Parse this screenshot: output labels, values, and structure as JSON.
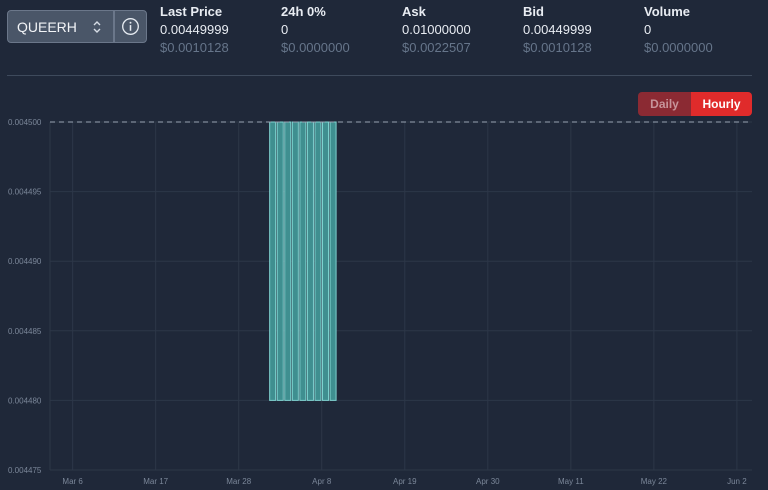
{
  "pair_selector": {
    "value": "QUEERH"
  },
  "stats": [
    {
      "label": "Last Price",
      "value": "0.00449999",
      "sub": "$0.0010128"
    },
    {
      "label": "24h 0%",
      "value": "0",
      "sub": "$0.0000000"
    },
    {
      "label": "Ask",
      "value": "0.01000000",
      "sub": "$0.0022507"
    },
    {
      "label": "Bid",
      "value": "0.00449999",
      "sub": "$0.0010128"
    },
    {
      "label": "Volume",
      "value": "0",
      "sub": "$0.0000000"
    }
  ],
  "toggle": {
    "daily_label": "Daily",
    "hourly_label": "Hourly",
    "active": "Hourly"
  },
  "chart_data": {
    "type": "bar",
    "title": "",
    "xlabel": "",
    "ylabel": "",
    "ylim": [
      0.004475,
      0.0045
    ],
    "y_ticks": [
      "0.004500",
      "0.004495",
      "0.004490",
      "0.004485",
      "0.004480",
      "0.004475"
    ],
    "x_ticks": [
      "Mar 6",
      "Mar 17",
      "Mar 28",
      "Apr 8",
      "Apr 19",
      "Apr 30",
      "May 11",
      "May 22",
      "Jun 2"
    ],
    "x_range": [
      "2024-03-03",
      "2024-06-04"
    ],
    "reference_line": {
      "value": 0.0045,
      "style": "dashed"
    },
    "bars": [
      {
        "date": "2024-04-01",
        "low": 0.00448,
        "high": 0.0045
      },
      {
        "date": "2024-04-02",
        "low": 0.00448,
        "high": 0.0045
      },
      {
        "date": "2024-04-03",
        "low": 0.00448,
        "high": 0.0045
      },
      {
        "date": "2024-04-04",
        "low": 0.00448,
        "high": 0.0045
      },
      {
        "date": "2024-04-05",
        "low": 0.00448,
        "high": 0.0045
      },
      {
        "date": "2024-04-06",
        "low": 0.00448,
        "high": 0.0045
      },
      {
        "date": "2024-04-07",
        "low": 0.00448,
        "high": 0.0045
      },
      {
        "date": "2024-04-08",
        "low": 0.00448,
        "high": 0.0045
      },
      {
        "date": "2024-04-09",
        "low": 0.00448,
        "high": 0.0045
      }
    ],
    "grid": true,
    "colors": {
      "bar_fill": "#3f8f90",
      "bar_stroke": "#7fd3d0",
      "grid": "#2d3748",
      "axis_text": "#7b8799",
      "ref_line": "#9aa5b4"
    }
  }
}
